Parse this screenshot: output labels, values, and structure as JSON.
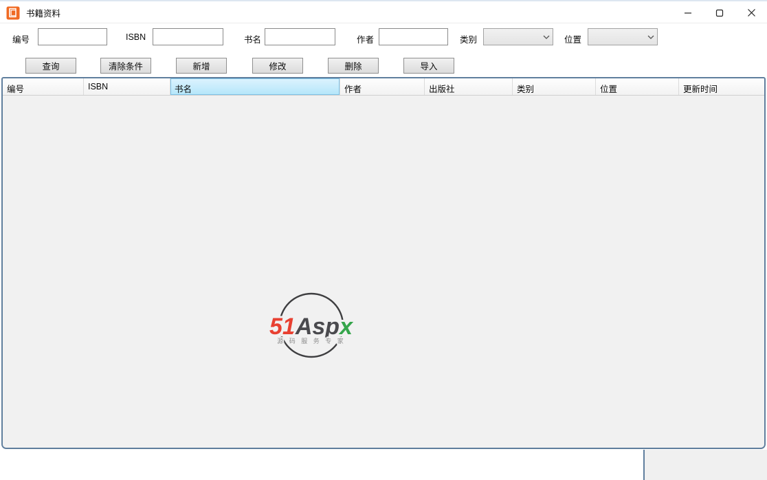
{
  "colors": {
    "accent_orange": "#f06a23",
    "grid_border": "#5f7e9d",
    "selected_column_fill": "#b4e6fa",
    "selected_column_border": "#7fc3e8",
    "brand_red": "#e84031",
    "brand_dark": "#4a4a4e",
    "brand_green": "#35a54b"
  },
  "titlebar": {
    "title": "书籍资料"
  },
  "filters": {
    "fields": [
      {
        "label": "编号",
        "type": "text",
        "value": ""
      },
      {
        "label": "ISBN",
        "type": "text",
        "value": ""
      },
      {
        "label": "书名",
        "type": "text",
        "value": ""
      },
      {
        "label": "作者",
        "type": "text",
        "value": ""
      },
      {
        "label": "类别",
        "type": "select",
        "value": ""
      },
      {
        "label": "位置",
        "type": "select",
        "value": ""
      }
    ]
  },
  "toolbar": {
    "buttons": [
      {
        "label": "查询"
      },
      {
        "label": "清除条件"
      },
      {
        "label": "新增"
      },
      {
        "label": "修改"
      },
      {
        "label": "删除"
      },
      {
        "label": "导入"
      }
    ]
  },
  "table": {
    "columns": [
      {
        "label": "编号"
      },
      {
        "label": "ISBN"
      },
      {
        "label": "书名",
        "selected": true
      },
      {
        "label": "作者"
      },
      {
        "label": "出版社"
      },
      {
        "label": "类别"
      },
      {
        "label": "位置"
      },
      {
        "label": "更新时间"
      }
    ],
    "rows": []
  },
  "watermark": {
    "brand_prefix": "51",
    "brand_main": "Asp",
    "brand_x": "x",
    "tagline": "源 码 服 务 专 家"
  }
}
